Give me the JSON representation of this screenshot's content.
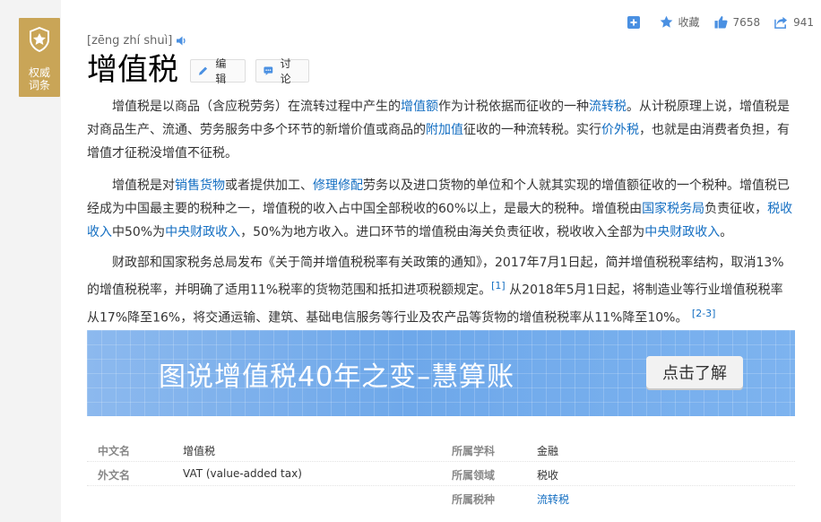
{
  "badge": {
    "label_line1": "权威",
    "label_line2": "词条",
    "icon": "medal-star-icon",
    "color": "#c9a557"
  },
  "toolbar": {
    "collect_label": "收藏",
    "like_count": "7658",
    "share_count": "941"
  },
  "entry": {
    "pinyin": "[zēng zhí shuì]",
    "title": "增值税",
    "edit_label": "编辑",
    "discuss_label": "讨论"
  },
  "paragraphs": {
    "p1": {
      "t1": "增值税是以商品（含应税劳务）在流转过程中产生的",
      "l1": "增值额",
      "t2": "作为计税依据而征收的一种",
      "l2": "流转税",
      "t3": "。从计税原理上说，增值税是对商品生产、流通、劳务服务中多个环节的新增价值或商品的",
      "l3": "附加值",
      "t4": "征收的一种流转税。实行",
      "l4": "价外税",
      "t5": "，也就是由消费者负担，有增值才征税没增值不征税。"
    },
    "p2": {
      "t1": "增值税是对",
      "l1": "销售货物",
      "t2": "或者提供加工、",
      "l2": "修理修配",
      "t3": "劳务以及进口货物的单位和个人就其实现的增值额征收的一个税种。增值税已经成为中国最主要的税种之一，增值税的收入占中国全部税收的60%以上，是最大的税种。增值税由",
      "l3": "国家税务局",
      "t4": "负责征收，",
      "l4": "税收收入",
      "t5": "中50%为",
      "l5": "中央财政收入",
      "t6": "，50%为地方收入。进口环节的增值税由海关负责征收，税收收入全部为",
      "l6": "中央财政收入",
      "t7": "。"
    },
    "p3": {
      "t1": "财政部和国家税务总局发布《关于简并增值税税率有关政策的通知》，2017年7月1日起，简并增值税税率结构，取消13%的增值税税率，并明确了适用11%税率的货物范围和抵扣进项税额规定。",
      "ref1": "[1]",
      "t2": " 从2018年5月1日起，将制造业等行业增值税税率从17%降至16%，将交通运输、建筑、基础电信服务等行业及农产品等货物的增值税税率从11%降至10%。",
      "ref2": "[2-3]"
    }
  },
  "banner": {
    "text": "图说增值税40年之变–慧算账",
    "button": "点击了解"
  },
  "infobox": {
    "rows": [
      {
        "k1": "中文名",
        "v1": "增值税",
        "k2": "所属学科",
        "v2": "金融"
      },
      {
        "k1": "外文名",
        "v1": "VAT (value-added tax)",
        "k2": "所属领域",
        "v2": "税收"
      },
      {
        "k1": "",
        "v1": "",
        "k2": "所属税种",
        "v2": "流转税"
      }
    ]
  },
  "colors": {
    "link": "#136ec2",
    "accent_blue": "#4a90e2",
    "gold": "#c9a557"
  }
}
